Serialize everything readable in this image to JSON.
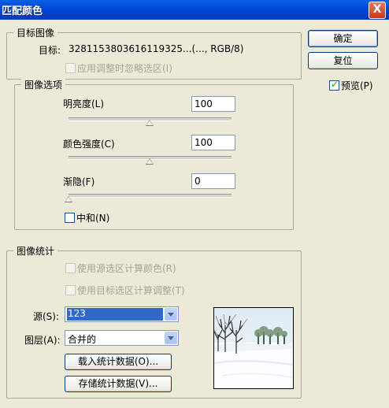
{
  "window": {
    "title": "匹配颜色",
    "close_label": "X"
  },
  "buttons": {
    "ok": "确定",
    "reset": "复位"
  },
  "preview_checkbox": {
    "label": "预览(P)",
    "checked": true
  },
  "target_image": {
    "group_label": "目标图像",
    "target_label": "目标:",
    "target_value": "3281153803616119325...(..., RGB/8)",
    "ignore_selection_label": "应用调整时忽略选区(I)"
  },
  "image_options": {
    "group_label": "图像选项",
    "luminance": {
      "label": "明亮度(L)",
      "value": "100",
      "level": 0.5
    },
    "color_intensity": {
      "label": "颜色强度(C)",
      "value": "100",
      "level": 0.5
    },
    "fade": {
      "label": "渐隐(F)",
      "value": "0",
      "level": 0
    },
    "neutralize": {
      "label": "中和(N)",
      "checked": false
    }
  },
  "image_statistics": {
    "group_label": "图像统计",
    "use_source_selection": "使用源选区计算颜色(R)",
    "use_target_selection": "使用目标选区计算调整(T)",
    "source_label": "源(S):",
    "source_value": "123",
    "layer_label": "图层(A):",
    "layer_value": "合并的",
    "load_button": "载入统计数据(O)...",
    "save_button": "存储统计数据(V)..."
  }
}
